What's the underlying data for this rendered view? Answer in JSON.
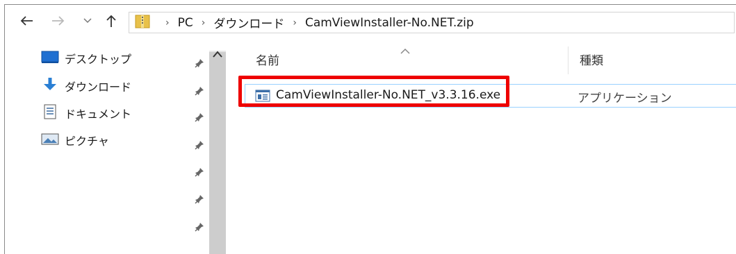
{
  "address": {
    "crumbs": [
      "PC",
      "ダウンロード",
      "CamViewInstaller-No.NET.zip"
    ],
    "zip_icon": "zip-folder-icon"
  },
  "nav": {
    "back": "back-arrow-icon",
    "forward": "forward-arrow-icon",
    "recent": "chevron-down-icon",
    "up": "up-arrow-icon"
  },
  "sidebar": {
    "items": [
      {
        "label": "デスクトップ",
        "icon": "desktop-icon"
      },
      {
        "label": "ダウンロード",
        "icon": "download-icon"
      },
      {
        "label": "ドキュメント",
        "icon": "documents-icon"
      },
      {
        "label": "ピクチャ",
        "icon": "pictures-icon"
      }
    ]
  },
  "filelist": {
    "columns": [
      "名前",
      "種類"
    ],
    "files": [
      {
        "name": "CamViewInstaller-No.NET_v3.3.16.exe",
        "type": "アプリケーション",
        "icon": "exe-app-icon"
      }
    ]
  },
  "colors": {
    "highlight": "#ee0000",
    "selection_border": "#99d1ff",
    "folder_yellow": "#e8c14a",
    "download_blue": "#2a7fd4"
  }
}
